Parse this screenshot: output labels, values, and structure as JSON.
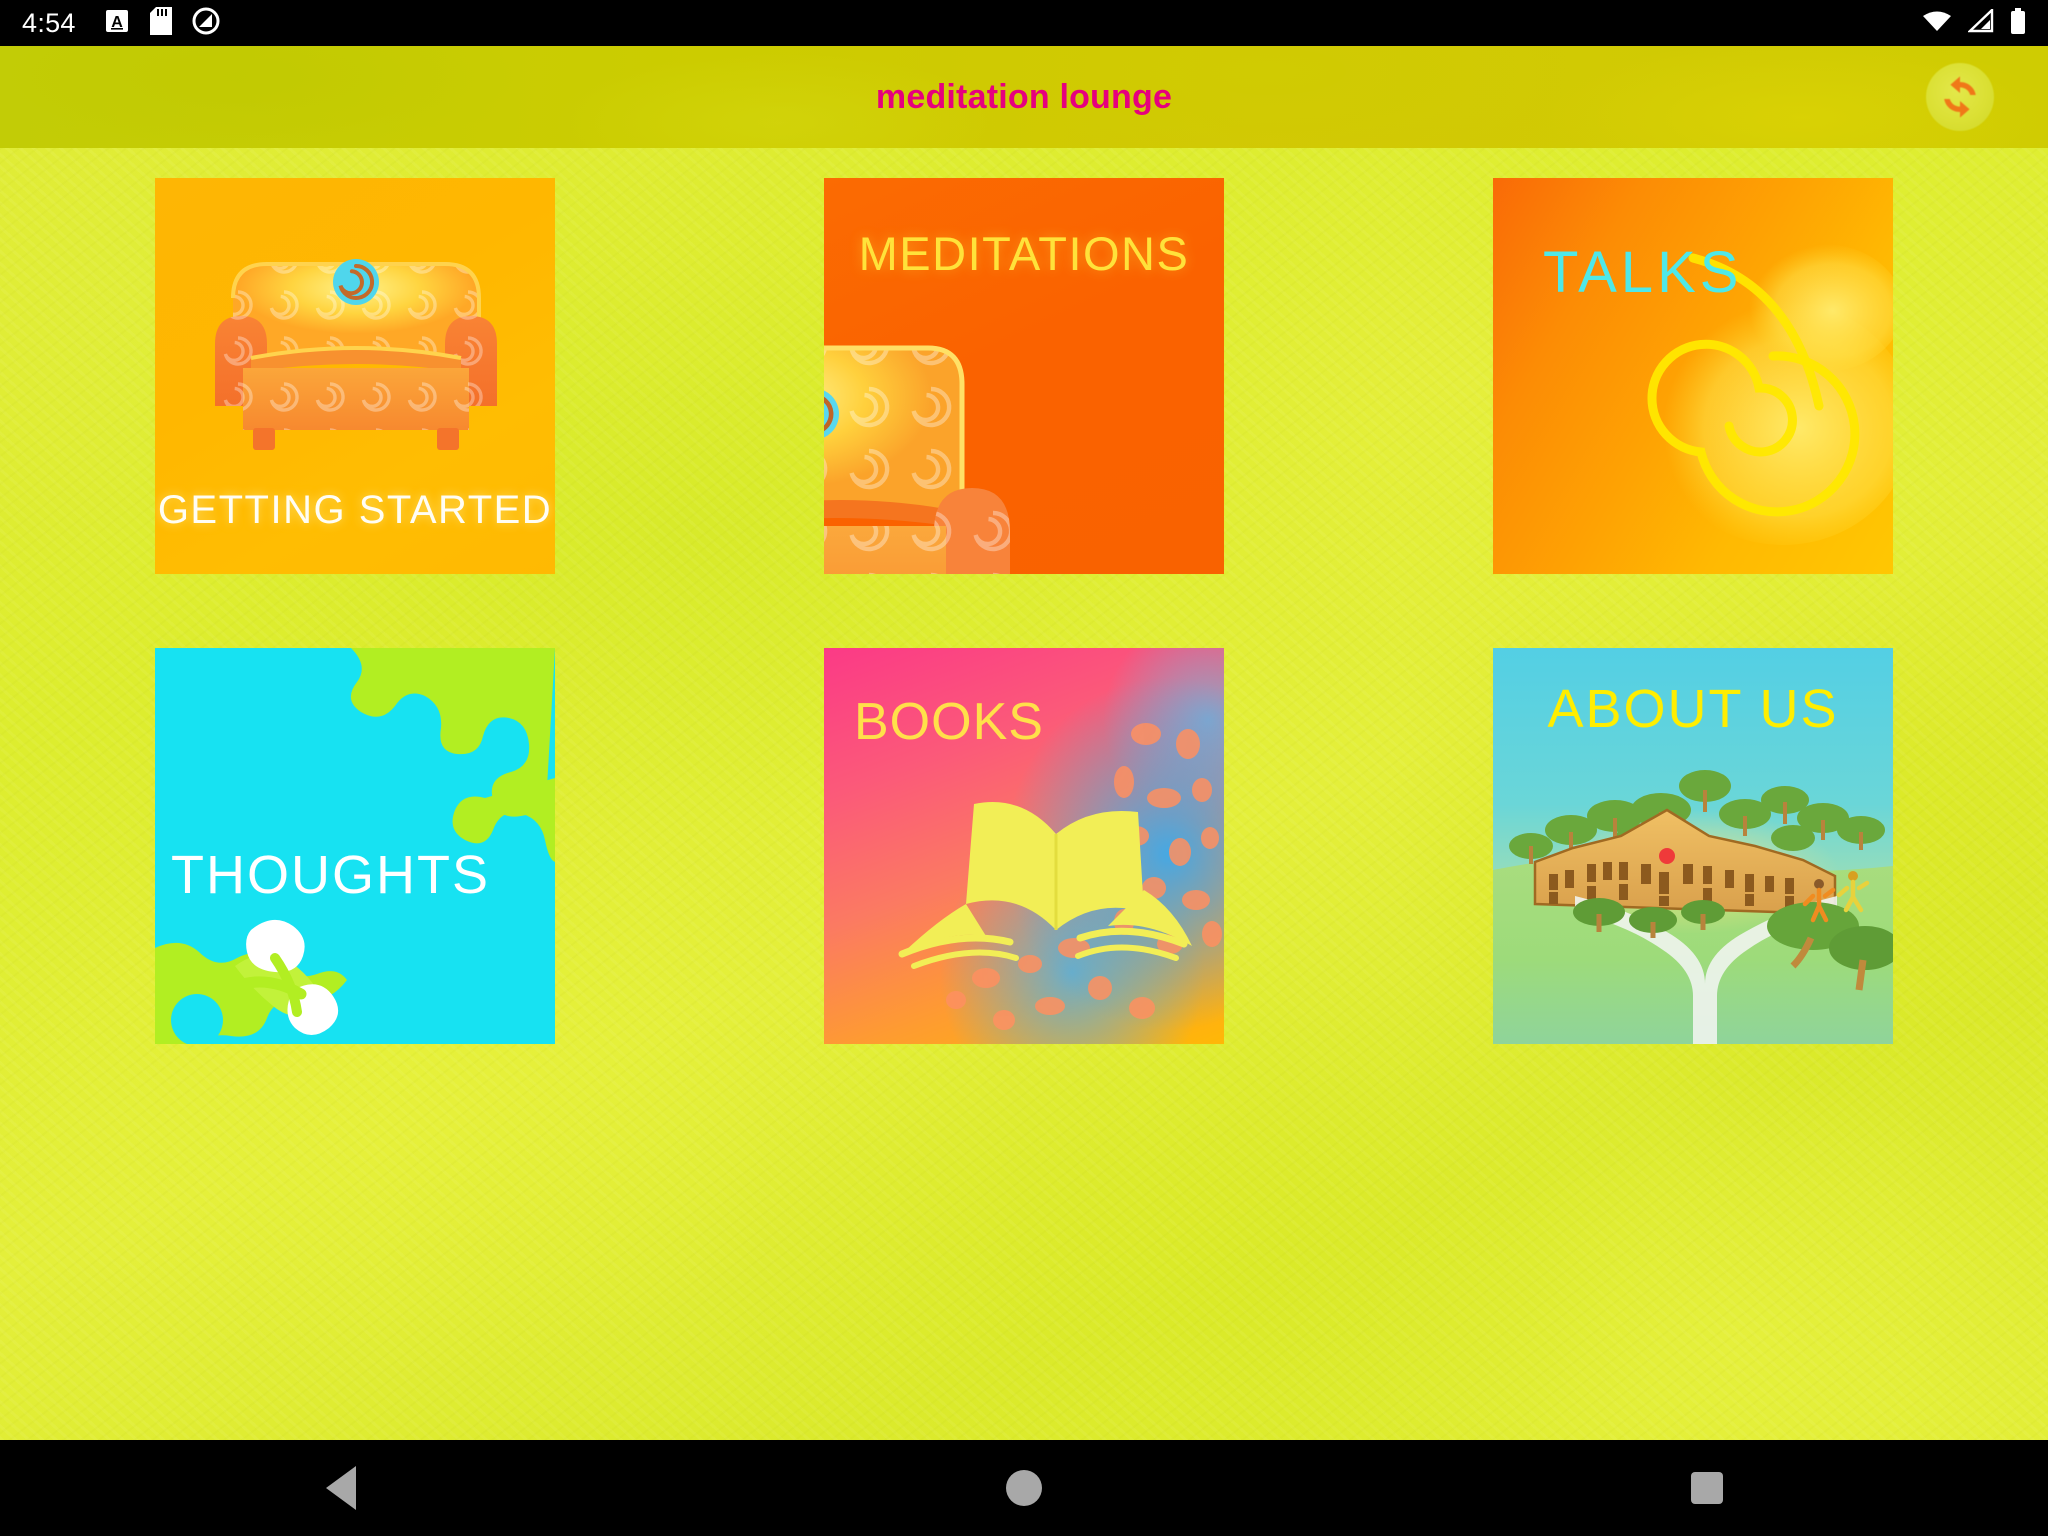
{
  "status_bar": {
    "time": "4:54",
    "left_icons": [
      "font-size-a-icon",
      "sd-card-icon",
      "do-not-disturb-icon"
    ],
    "right_icons": [
      "wifi-icon",
      "cellular-signal-icon",
      "battery-icon"
    ]
  },
  "app_bar": {
    "title": "meditation lounge",
    "title_color": "#e6007e",
    "background_color": "#cccc00",
    "refresh_icon": "refresh-sync-icon",
    "refresh_icon_color": "#f07818",
    "refresh_disc_color": "#dbe034"
  },
  "background": {
    "color": "#e0ec34",
    "description": "mottled yellow-green watercolor texture"
  },
  "grid": {
    "columns": 3,
    "rows": 2,
    "tiles": [
      {
        "id": "getting-started",
        "label": "GETTING STARTED",
        "label_color": "#fffdf4",
        "label_position": "bottom-center",
        "background_color": "#ffb702",
        "artwork": "armchair-with-spirals-icon"
      },
      {
        "id": "meditations",
        "label": "MEDITATIONS",
        "label_color": "#ffe23a",
        "label_position": "top-center",
        "background_color": "#fa6200",
        "artwork": "armchair-closeup-icon"
      },
      {
        "id": "talks",
        "label": "TALKS",
        "label_color": "#4fe8e8",
        "label_position": "top-left",
        "background_color": "#ffa802",
        "artwork": "spiral-shell-icon"
      },
      {
        "id": "thoughts",
        "label": "THOUGHTS",
        "label_color": "#ffffff",
        "label_position": "middle-left",
        "background_color": "#17e2f2",
        "artwork": "green-leaf-blossom-icon"
      },
      {
        "id": "books",
        "label": "BOOKS",
        "label_color": "#ffe04a",
        "label_position": "top-left",
        "background_color": "#fb5a79",
        "artwork": "open-book-icon"
      },
      {
        "id": "about-us",
        "label": "ABOUT US",
        "label_color": "#ffee00",
        "label_position": "top-center",
        "background_color": "#62cfe0",
        "artwork": "landscape-building-painting"
      }
    ]
  },
  "nav_bar": {
    "back_label": "Back",
    "home_label": "Home",
    "recents_label": "Recents",
    "icon_color": "#a8a8a8"
  }
}
